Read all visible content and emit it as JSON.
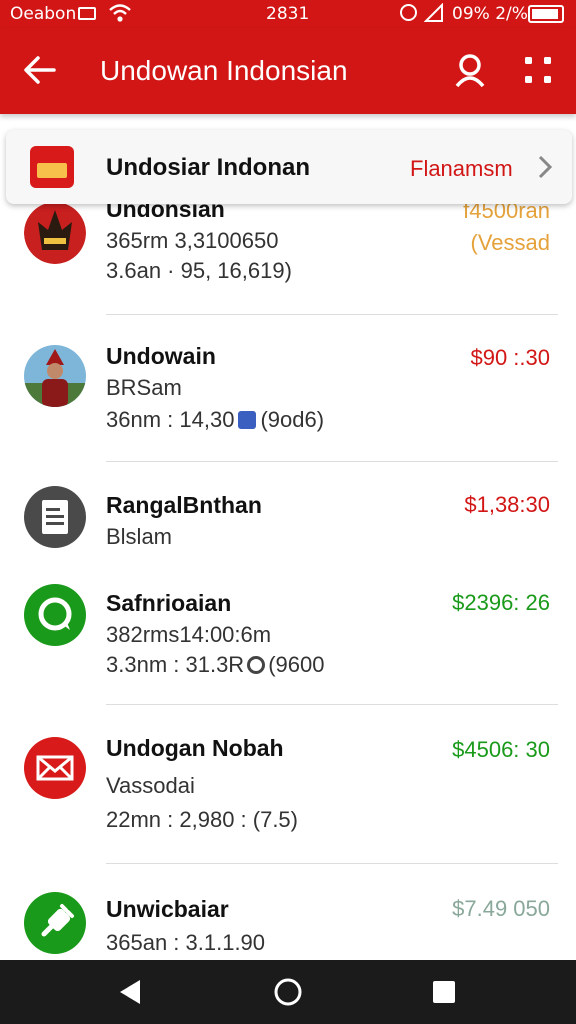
{
  "status_bar": {
    "carrier": "Oeabon",
    "time": "2831",
    "battery_text": "09% 2/%",
    "icons": [
      "sim-icon",
      "wifi-icon",
      "alarm-icon",
      "signal-icon",
      "battery-icon"
    ]
  },
  "app_bar": {
    "title": "Undowan Indonsian",
    "icons": [
      "back-arrow-icon",
      "search-icon",
      "more-icon"
    ]
  },
  "filter": {
    "name": "Undosiar Indonan",
    "action": "Flanamsm"
  },
  "transactions": [
    {
      "name": "Undonsian",
      "line1": "365rm  3,3100650",
      "line2": "3.6an  ·  95, 16,619)",
      "amount": "f4500ran",
      "amount_sub": "(Vessad",
      "amount_color": "#e5a23b",
      "icon": "mask-avatar"
    },
    {
      "name": "Undowain",
      "line1": "BRSam",
      "line2": "36nm : 14,30",
      "line2_suffix": "(9od6)",
      "amount": "$90 :.30",
      "amount_color": "#d21616",
      "icon": "person-avatar"
    },
    {
      "name": "RangalBnthan",
      "line1": "Blslam",
      "amount": "$1,38:30",
      "amount_color": "#d21616",
      "icon": "document-icon"
    },
    {
      "name": "Safnrioaian",
      "line1": "382rms14:00:6m",
      "line2": "3.3nm :  31.3R",
      "line2_suffix": "(9600",
      "amount": "$2396: 26",
      "amount_color": "#1a9a1a",
      "icon": "chat-icon"
    },
    {
      "name": "Undogan Nobah",
      "line1": "Vassodai",
      "line2": "22mn :  2,980 :  (7.5)",
      "amount": "$4506: 30",
      "amount_color": "#1a9a1a",
      "icon": "mail-icon"
    },
    {
      "name": "Unwicbaiar",
      "line1": "365an :  3.1.1.90",
      "amount": "$7.49 050",
      "amount_color": "#8aa89a",
      "icon": "plug-icon"
    }
  ],
  "nav": {
    "icons": [
      "nav-back-icon",
      "nav-home-icon",
      "nav-recents-icon"
    ]
  }
}
